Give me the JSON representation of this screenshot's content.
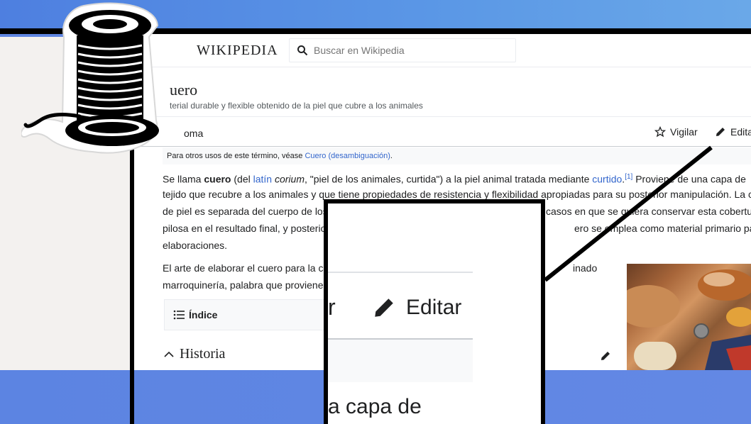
{
  "header": {
    "logo": "WIKIPEDIA",
    "search_placeholder": "Buscar en Wikipedia"
  },
  "article": {
    "title": "uero",
    "subtitle": "terial durable y flexible obtenido de la piel que cubre a los animales",
    "lang_label": "oma",
    "watch_label": "Vigilar",
    "edit_label": "Edita",
    "hatnote_prefix": "Para otros usos de este término, véase",
    "hatnote_link": "Cuero (desambiguación)",
    "hatnote_suffix": ".",
    "p1_line1_a": "Se llama",
    "p1_bold": "cuero",
    "p1_line1_b": "(del",
    "p1_link_latin": "latín",
    "p1_italic": "corium",
    "p1_line1_c": ", \"piel de los animales, curtida\") a la piel animal tratada mediante",
    "p1_link_curtido": "curtido",
    "p1_sup": "[1]",
    "p1_line1_d": "Proviene de una capa de",
    "p1_line2": "tejido que recubre a los animales y que tiene propiedades de resistencia y flexibilidad apropiadas para su posterior manipulación. La cap",
    "p1_line3_a": "de piel es separada del cuerpo de los",
    "p1_line3_b": "casos en que se quiera conservar esta cobertura",
    "p1_line4_a": "pilosa en el resultado final, y posterio",
    "p1_line4_b": "ero se emplea como material primario para otras",
    "p1_line5": "elaboraciones.",
    "p2_line1_a": "El arte de elaborar el cuero para la co",
    "p2_line1_b": "inado",
    "p2_line2": "marroquinería, palabra que proviene",
    "indice_label": "Índice",
    "historia_label": "Historia"
  },
  "zoom": {
    "partial_r": "r",
    "edit_label": "Editar",
    "bottom_text": "a capa de"
  },
  "colors": {
    "link": "#3366cc",
    "text": "#202122",
    "background_blue": "#5f86e2"
  }
}
